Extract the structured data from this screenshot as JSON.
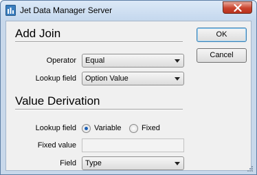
{
  "window": {
    "title": "Jet Data Manager Server"
  },
  "add_join": {
    "heading": "Add Join",
    "operator_label": "Operator",
    "operator_value": "Equal",
    "lookup_field_label": "Lookup field",
    "lookup_field_value": "Option Value"
  },
  "value_derivation": {
    "heading": "Value Derivation",
    "lookup_field_label": "Lookup field",
    "option_variable": "Variable",
    "option_fixed": "Fixed",
    "selected_option": "Variable",
    "fixed_value_label": "Fixed value",
    "fixed_value": "",
    "field_label": "Field",
    "field_value": "Type"
  },
  "buttons": {
    "ok": "OK",
    "cancel": "Cancel"
  },
  "colors": {
    "accent": "#1b5fb5",
    "titlebar": "#c5d8ee",
    "close": "#c9432d"
  }
}
